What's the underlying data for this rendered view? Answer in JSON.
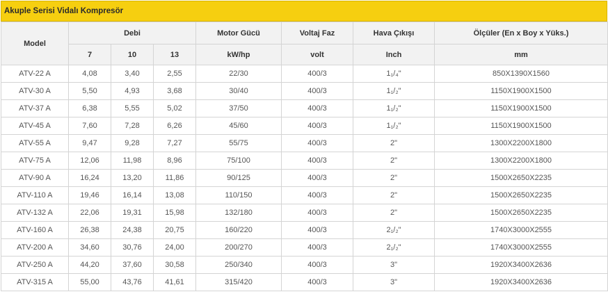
{
  "title": "Akuple Serisi Vidalı Kompresör",
  "headers": {
    "model": "Model",
    "debi": "Debi",
    "debi_cols": [
      "7",
      "10",
      "13"
    ],
    "motor": "Motor Gücü",
    "motor_unit": "kW/hp",
    "voltaj": "Voltaj Faz",
    "voltaj_unit": "volt",
    "hava": "Hava Çıkışı",
    "hava_unit": "Inch",
    "olculer": "Ölçüler (En x Boy x Yüks.)",
    "olculer_unit": "mm"
  },
  "rows": [
    {
      "model": "ATV-22 A",
      "d7": "4,08",
      "d10": "3,40",
      "d13": "2,55",
      "motor": "22/30",
      "volt": "400/3",
      "hava": "1₁/₄\"",
      "olcu": "850X1390X1560"
    },
    {
      "model": "ATV-30 A",
      "d7": "5,50",
      "d10": "4,93",
      "d13": "3,68",
      "motor": "30/40",
      "volt": "400/3",
      "hava": "1₁/₂\"",
      "olcu": "1150X1900X1500"
    },
    {
      "model": "ATV-37 A",
      "d7": "6,38",
      "d10": "5,55",
      "d13": "5,02",
      "motor": "37/50",
      "volt": "400/3",
      "hava": "1₁/₂\"",
      "olcu": "1150X1900X1500"
    },
    {
      "model": "ATV-45 A",
      "d7": "7,60",
      "d10": "7,28",
      "d13": "6,26",
      "motor": "45/60",
      "volt": "400/3",
      "hava": "1₁/₂\"",
      "olcu": "1150X1900X1500"
    },
    {
      "model": "ATV-55 A",
      "d7": "9,47",
      "d10": "9,28",
      "d13": "7,27",
      "motor": "55/75",
      "volt": "400/3",
      "hava": "2\"",
      "olcu": "1300X2200X1800"
    },
    {
      "model": "ATV-75 A",
      "d7": "12,06",
      "d10": "11,98",
      "d13": "8,96",
      "motor": "75/100",
      "volt": "400/3",
      "hava": "2\"",
      "olcu": "1300X2200X1800"
    },
    {
      "model": "ATV-90 A",
      "d7": "16,24",
      "d10": "13,20",
      "d13": "11,86",
      "motor": "90/125",
      "volt": "400/3",
      "hava": "2\"",
      "olcu": "1500X2650X2235"
    },
    {
      "model": "ATV-110 A",
      "d7": "19,46",
      "d10": "16,14",
      "d13": "13,08",
      "motor": "110/150",
      "volt": "400/3",
      "hava": "2\"",
      "olcu": "1500X2650X2235"
    },
    {
      "model": "ATV-132 A",
      "d7": "22,06",
      "d10": "19,31",
      "d13": "15,98",
      "motor": "132/180",
      "volt": "400/3",
      "hava": "2\"",
      "olcu": "1500X2650X2235"
    },
    {
      "model": "ATV-160 A",
      "d7": "26,38",
      "d10": "24,38",
      "d13": "20,75",
      "motor": "160/220",
      "volt": "400/3",
      "hava": "2₁/₂\"",
      "olcu": "1740X3000X2555"
    },
    {
      "model": "ATV-200 A",
      "d7": "34,60",
      "d10": "30,76",
      "d13": "24,00",
      "motor": "200/270",
      "volt": "400/3",
      "hava": "2₁/₂\"",
      "olcu": "1740X3000X2555"
    },
    {
      "model": "ATV-250 A",
      "d7": "44,20",
      "d10": "37,60",
      "d13": "30,58",
      "motor": "250/340",
      "volt": "400/3",
      "hava": "3\"",
      "olcu": "1920X3400X2636"
    },
    {
      "model": "ATV-315 A",
      "d7": "55,00",
      "d10": "43,76",
      "d13": "41,61",
      "motor": "315/420",
      "volt": "400/3",
      "hava": "3\"",
      "olcu": "1920X3400X2636"
    }
  ]
}
